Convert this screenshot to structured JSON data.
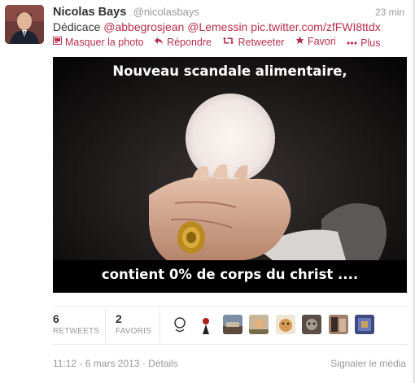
{
  "tweet": {
    "author_name": "Nicolas Bays",
    "author_handle": "@nicolasbays",
    "time_ago": "23 min",
    "text_prefix": "Dédicace",
    "mention1": "@abbegrosjean",
    "mention2": "@Lemessin",
    "pic_link": "pic.twitter.com/zfFWI8ttdx",
    "actions": {
      "hide_photo": "Masquer la photo",
      "reply": "Répondre",
      "retweet": "Retweeter",
      "favorite": "Favori",
      "more": "Plus"
    },
    "media_caption_top": "Nouveau scandale alimentaire,",
    "media_caption_bottom": "contient 0% de corps du christ ....",
    "stats": {
      "retweets_count": "6",
      "retweets_label": "RETWEETS",
      "favorites_count": "2",
      "favorites_label": "FAVORIS"
    },
    "timestamp": "11:12 - 6 mars 2013 · Détails",
    "report_media": "Signaler le média"
  },
  "colors": {
    "link": "#b82e4e",
    "muted": "#999999"
  }
}
